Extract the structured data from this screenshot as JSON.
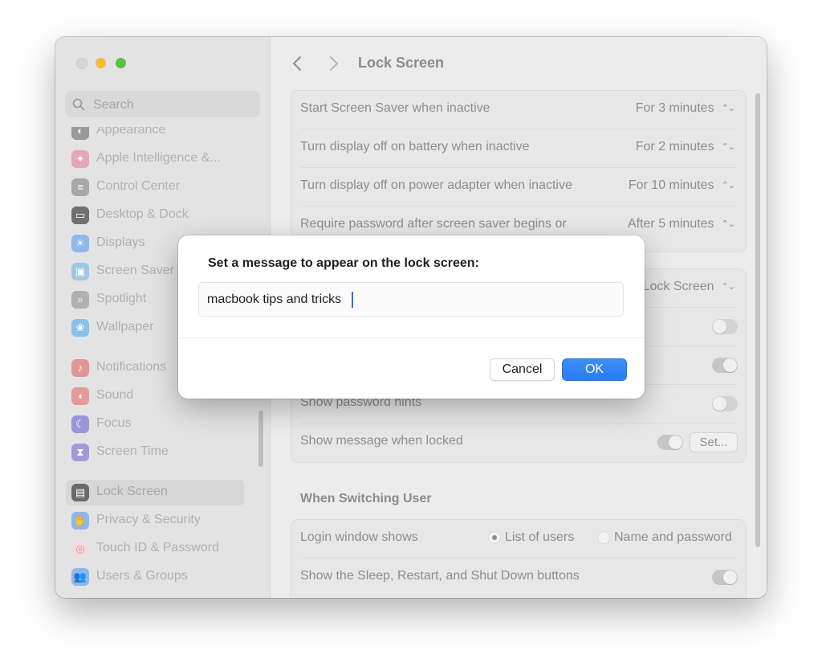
{
  "window": {
    "title": "Lock Screen"
  },
  "sidebar": {
    "search_placeholder": "Search",
    "items": [
      {
        "label": "Appearance",
        "icon": "appearance-icon",
        "color": "#9a9a9a"
      },
      {
        "label": "Apple Intelligence &...",
        "icon": "apple-intelligence-icon",
        "color": "#e3a7b7"
      },
      {
        "label": "Control Center",
        "icon": "control-center-icon",
        "color": "#a8a8a8"
      },
      {
        "label": "Desktop & Dock",
        "icon": "desktop-dock-icon",
        "color": "#707070"
      },
      {
        "label": "Displays",
        "icon": "displays-icon",
        "color": "#8fb8ee"
      },
      {
        "label": "Screen Saver",
        "icon": "screen-saver-icon",
        "color": "#9cc8e6"
      },
      {
        "label": "Spotlight",
        "icon": "spotlight-icon",
        "color": "#b1b1b1"
      },
      {
        "label": "Wallpaper",
        "icon": "wallpaper-icon",
        "color": "#88c2eb"
      },
      {
        "label": "Notifications",
        "icon": "notifications-icon",
        "color": "#e49595"
      },
      {
        "label": "Sound",
        "icon": "sound-icon",
        "color": "#e59a9a"
      },
      {
        "label": "Focus",
        "icon": "focus-icon",
        "color": "#9b95db"
      },
      {
        "label": "Screen Time",
        "icon": "screen-time-icon",
        "color": "#a19bda"
      },
      {
        "label": "Lock Screen",
        "icon": "lock-screen-icon",
        "color": "#6a6a6a"
      },
      {
        "label": "Privacy & Security",
        "icon": "privacy-security-icon",
        "color": "#8fb6ec"
      },
      {
        "label": "Touch ID & Password",
        "icon": "touch-id-icon",
        "color": "#e7a6a6"
      },
      {
        "label": "Users & Groups",
        "icon": "users-groups-icon",
        "color": "#8fb6ec"
      }
    ]
  },
  "main": {
    "title": "Lock Screen",
    "settings": [
      {
        "label": "Start Screen Saver when inactive",
        "value": "For 3 minutes"
      },
      {
        "label": "Turn display off on battery when inactive",
        "value": "For 2 minutes"
      },
      {
        "label": "Turn display off on power adapter when inactive",
        "value": "For 10 minutes"
      },
      {
        "label": "Require password after screen saver begins or",
        "value": "After 5 minutes"
      }
    ],
    "group2": {
      "popup_value": "Lock Screen",
      "show_password_hints": "Show password hints",
      "show_message_when_locked": "Show message when locked",
      "set_button": "Set..."
    },
    "switching": {
      "title": "When Switching User",
      "login_window_shows": "Login window shows",
      "option_list": "List of users",
      "option_name": "Name and password",
      "show_buttons": "Show the Sleep, Restart, and Shut Down buttons"
    }
  },
  "dialog": {
    "prompt": "Set a message to appear on the lock screen:",
    "input_value": "macbook tips and tricks",
    "cancel": "Cancel",
    "ok": "OK"
  },
  "colors": {
    "accent": "#2a7cf1"
  }
}
